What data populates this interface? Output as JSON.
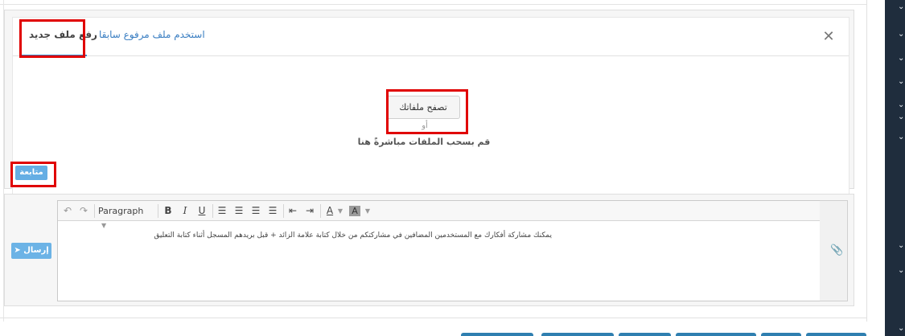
{
  "dialog": {
    "tab_new_label": "رفع ملف جديد",
    "tab_previous_label": "استخدم ملف مرفوع سابقا",
    "close_icon": "close-icon",
    "browse_button_label": "تصفح ملفاتك",
    "or_text": "أو",
    "drop_hint": "قم بسحب الملفات مباشرةً هنا",
    "continue_button_label": "متابعة"
  },
  "comment": {
    "send_button_label": "إرسال",
    "send_icon": "paper-plane-icon",
    "format_select_value": "Paragraph",
    "editor_text": "يمكنك مشاركة أفكارك مع المستخدمين المضافين في مشاركتكم من خلال كتابة علامة الزائد + قبل بريدهم المسجل أثناء كتابة التعليق",
    "attach_icon": "paperclip-icon",
    "toolbar_icons": [
      "undo-icon",
      "redo-icon",
      "bold-icon",
      "italic-icon",
      "underline-icon",
      "align-left-icon",
      "align-center-icon",
      "align-right-icon",
      "align-justify-icon",
      "outdent-icon",
      "indent-icon",
      "text-color-icon",
      "background-color-icon"
    ]
  },
  "colors": {
    "accent": "#3b86c6",
    "button_blue": "#65aee4",
    "highlight_red": "#e00000",
    "sidebar_dark": "#1f2d3d"
  }
}
